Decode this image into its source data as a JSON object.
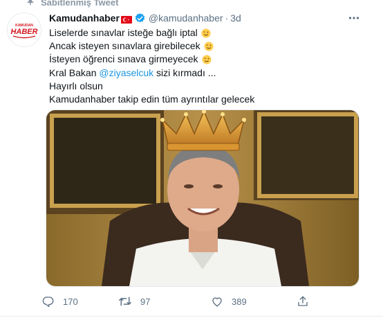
{
  "pinned": {
    "label": "Sabitlenmiş Tweet"
  },
  "author": {
    "name": "Kamudanhaber",
    "handle": "@kamudanhaber",
    "separator": "·",
    "time": "3d"
  },
  "avatar": {
    "logo_small": "KAMUDAN",
    "logo_big": "HABER"
  },
  "tweet": {
    "line1": "Liselerde sınavlar isteğe bağlı iptal",
    "line2": "Ancak isteyen sınavlara girebilecek",
    "line3": "İsteyen öğrenci sınava girmeyecek",
    "line4_prefix": "Kral Bakan ",
    "mention": "@ziyaselcuk",
    "line4_suffix": " sizi kırmadı ...",
    "line5": "Hayırlı olsun",
    "line6": "Kamudanhaber takip edin tüm ayrıntılar gelecek"
  },
  "actions": {
    "replies": "170",
    "retweets": "97",
    "likes": "389"
  },
  "icons": [
    "pin-icon",
    "turkish-flag-icon",
    "verified-badge-icon",
    "more-icon",
    "winking-face-icon",
    "reply-icon",
    "retweet-icon",
    "like-icon",
    "share-icon"
  ],
  "colors": {
    "accent": "#1da1f2",
    "mention": "#1b95e0",
    "secondary_text": "#5b7083",
    "flag_red": "#e30a17",
    "logo_red": "#d2141e"
  }
}
